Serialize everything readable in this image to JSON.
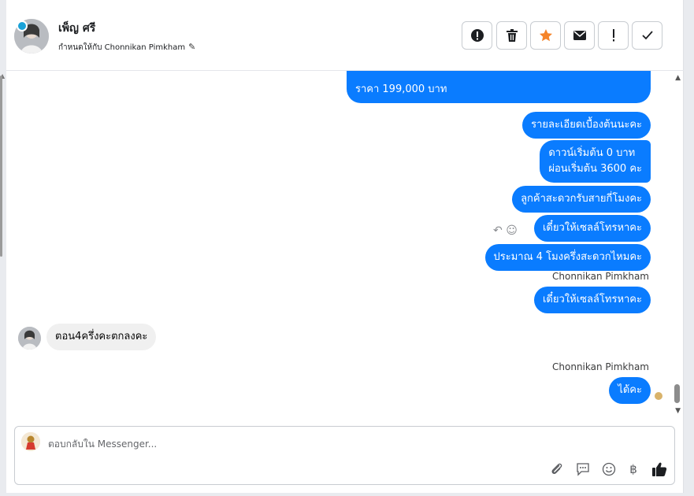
{
  "header": {
    "contact_name": "เพ็ญ ศรี",
    "assigned_text": "กำหนดให้กับ Chonnikan Pimkham",
    "buttons": [
      {
        "name": "report-spam",
        "icon": "exclamation-circle-icon"
      },
      {
        "name": "delete",
        "icon": "trash-icon"
      },
      {
        "name": "star",
        "icon": "star-icon",
        "color": "#f5842a"
      },
      {
        "name": "mark-unread",
        "icon": "envelope-icon"
      },
      {
        "name": "follow-up",
        "icon": "exclamation-icon"
      },
      {
        "name": "mark-done",
        "icon": "check-icon"
      }
    ]
  },
  "messages": [
    {
      "direction": "out",
      "text": "ราคา 199,000 บาท"
    },
    {
      "direction": "out",
      "text": "รายละเอียดเบื้องต้นนะคะ"
    },
    {
      "direction": "out",
      "lines": [
        "ดาวน์เริ่มต้น 0 บาท",
        "ผ่อนเริ่มต้น 3600 คะ"
      ]
    },
    {
      "direction": "out",
      "text": "ลูกค้าสะดวกรับสายกี่โมงคะ"
    },
    {
      "direction": "out",
      "text": "เดี๋ยวให้เซลล์โทรหาคะ"
    },
    {
      "direction": "out",
      "text": "ประมาณ 4 โมงครึ่งสะดวกไหมคะ"
    },
    {
      "direction": "out",
      "sender": "Chonnikan Pimkham",
      "text": "เดี๋ยวให้เซลล์โทรหาคะ"
    },
    {
      "direction": "in",
      "text": "ตอน4ครึ่งคะตกลงคะ"
    },
    {
      "direction": "out",
      "sender": "Chonnikan Pimkham",
      "text": "ได้คะ"
    }
  ],
  "composer": {
    "placeholder": "ตอบกลับใน Messenger...",
    "icons": [
      "paperclip-icon",
      "saved-reply-icon",
      "emoji-icon",
      "baht-icon",
      "thumbs-up-icon"
    ]
  },
  "colors": {
    "accent": "#0a7cff",
    "incoming_bubble": "#f0f0f0",
    "star": "#f5842a"
  }
}
